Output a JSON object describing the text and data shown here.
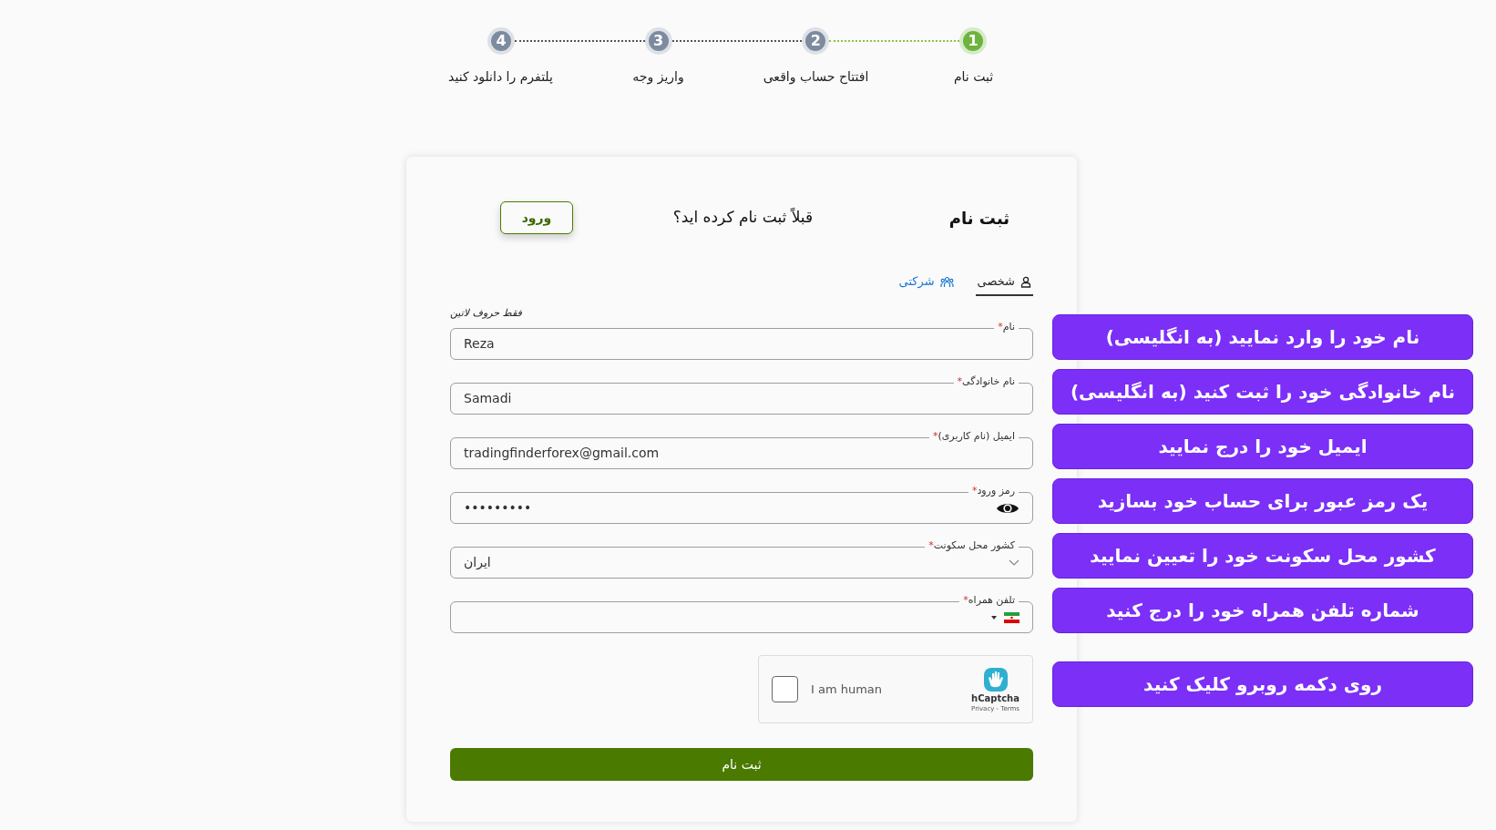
{
  "stepper": {
    "steps": [
      {
        "number": "1",
        "label": "ثبت نام",
        "selected": true
      },
      {
        "number": "2",
        "label": "افتتاح حساب واقعی",
        "selected": false
      },
      {
        "number": "3",
        "label": "واریز وجه",
        "selected": false
      },
      {
        "number": "4",
        "label": "پلتفرم را دانلود کنید",
        "selected": false
      }
    ]
  },
  "card": {
    "title": "ثبت نام",
    "question": "قبلاً ثبت نام کرده اید؟",
    "login_button": "ورود",
    "tabs": [
      {
        "label": "شخصی",
        "kind": "person",
        "selected": true
      },
      {
        "label": "شرکتی",
        "kind": "group",
        "selected": false
      }
    ],
    "hint": "فقط حروف لاتین",
    "fields": [
      {
        "kind": "text",
        "label": "نام",
        "required_mark": "*",
        "value": "Reza"
      },
      {
        "kind": "text",
        "label": "نام خانوادگی",
        "required_mark": "*",
        "value": "Samadi"
      },
      {
        "kind": "text",
        "label": "ایمیل (نام کاربری)",
        "required_mark": "*",
        "value": "tradingfinderforex@gmail.com"
      },
      {
        "kind": "password",
        "label": "رمز ورود",
        "required_mark": "*",
        "value": "•••••••••"
      },
      {
        "kind": "select",
        "label": "کشور محل سکونت",
        "required_mark": "*",
        "value": "ایران"
      },
      {
        "kind": "phone",
        "label": "تلفن همراه",
        "required_mark": "*"
      }
    ],
    "captcha": {
      "label": "I am human",
      "checked": false,
      "brand": "hCaptcha",
      "links": "Privacy - Terms"
    },
    "submit": "ثبت نام"
  },
  "callouts": [
    "نام خود را وارد نمایید (به انگلیسی)",
    "نام خانوادگی خود را ثبت کنید (به انگلیسی)",
    "ایمیل خود را درج نمایید",
    "یک رمز عبور برای حساب خود بسازید",
    "کشور محل سکونت خود را تعیین نمایید",
    "شماره تلفن همراه خود را درج کنید",
    "روی دکمه روبرو کلیک کنید"
  ]
}
